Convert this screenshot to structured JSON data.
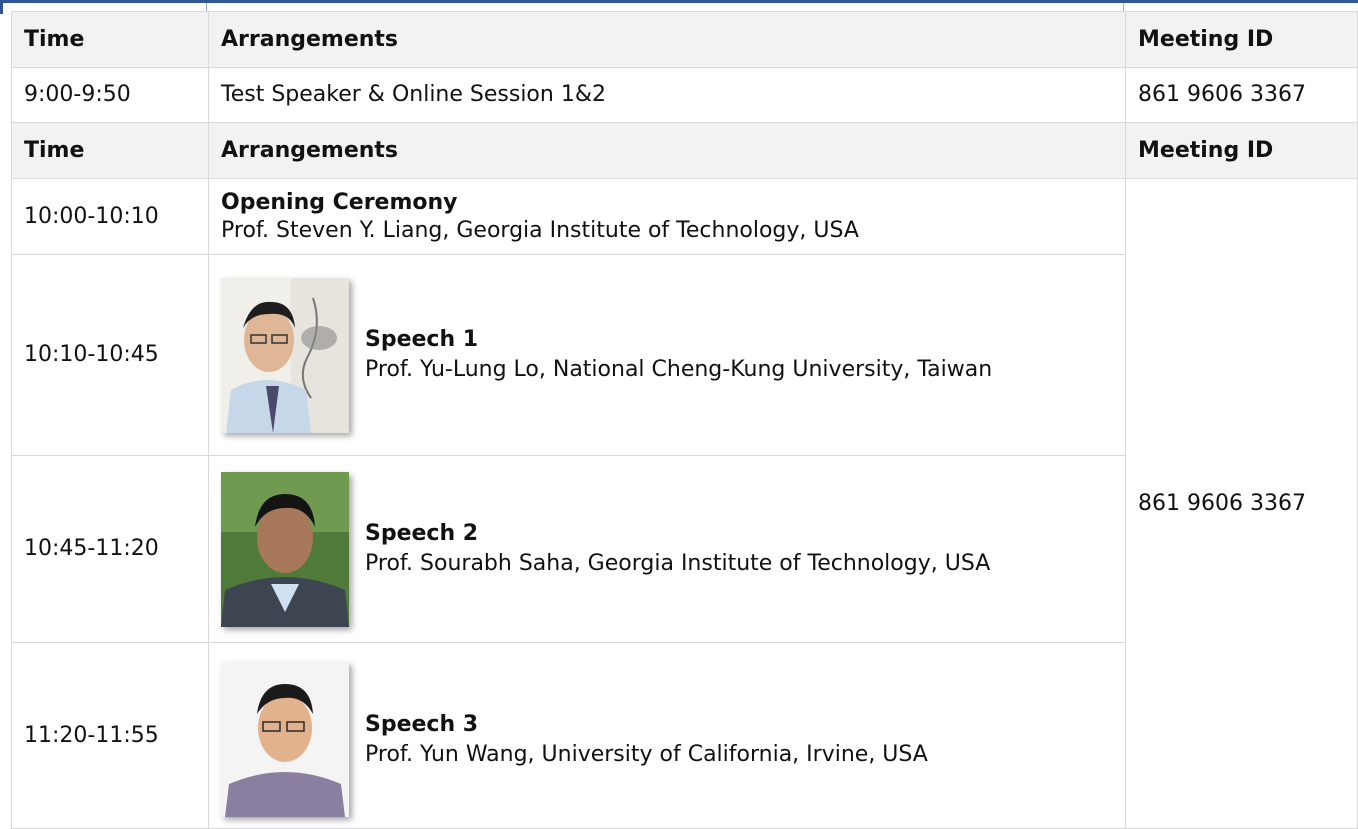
{
  "headers": {
    "time": "Time",
    "arrangements": "Arrangements",
    "meeting_id": "Meeting ID"
  },
  "rows": [
    {
      "time": "9:00-9:50",
      "arrangement": "Test Speaker & Online Session 1&2",
      "meeting_id": "861 9606 3367"
    }
  ],
  "sessions": [
    {
      "time": "10:00-10:10",
      "title": "Opening Ceremony",
      "speaker": "Prof. Steven Y. Liang, Georgia Institute of Technology, USA"
    },
    {
      "time": "10:10-10:45",
      "title": "Speech 1",
      "speaker": "Prof. Yu-Lung Lo, National Cheng-Kung University, Taiwan",
      "photo": "speaker-photo"
    },
    {
      "time": "10:45-11:20",
      "title": "Speech 2",
      "speaker": "Prof. Sourabh Saha, Georgia Institute of Technology, USA",
      "photo": "speaker-photo"
    },
    {
      "time": "11:20-11:55",
      "title": "Speech 3",
      "speaker": "Prof. Yun Wang, University of California, Irvine, USA",
      "photo": "speaker-photo"
    }
  ],
  "session_meeting_id": "861 9606 3367",
  "colors": {
    "frame": "#2f5597",
    "header_bg": "#f2f2f2",
    "border": "#d9d9d9"
  }
}
